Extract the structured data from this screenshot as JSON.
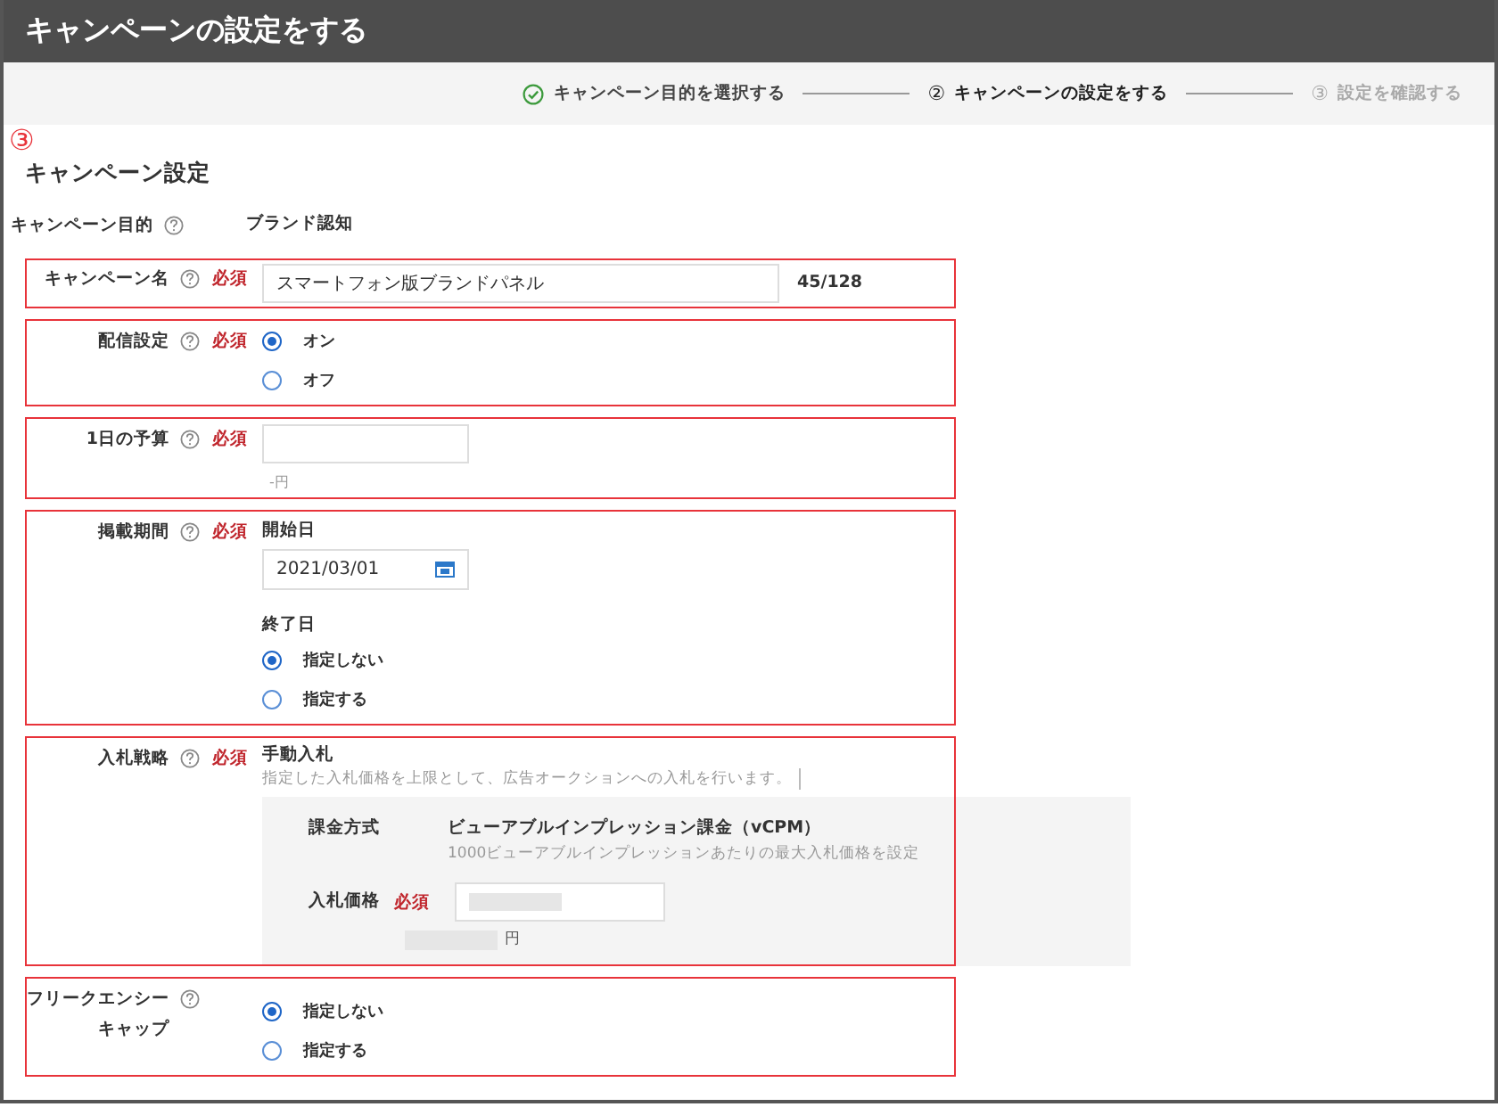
{
  "header": {
    "title": "キャンペーンの設定をする"
  },
  "steps": [
    {
      "label": "キャンペーン目的を選択する",
      "done": true,
      "selected": false
    },
    {
      "number": "②",
      "label": "キャンペーンの設定をする",
      "done": false,
      "selected": true
    },
    {
      "number": "③",
      "label": "設定を確認する",
      "done": false,
      "selected": false
    }
  ],
  "annotation": "③",
  "section_title": "キャンペーン設定",
  "fields": [
    {
      "kind": "static",
      "label": "キャンペーン目的",
      "value": "ブランド認知",
      "highlighted": false
    },
    {
      "kind": "text",
      "label": "キャンペーン名",
      "required": "必須",
      "value": "スマートフォン版ブランドパネル",
      "counter": "45/128",
      "highlighted": true
    },
    {
      "kind": "radio",
      "label": "配信設定",
      "required": "必須",
      "options": [
        {
          "label": "オン",
          "selected": true
        },
        {
          "label": "オフ",
          "selected": false
        }
      ],
      "highlighted": true
    },
    {
      "kind": "budget",
      "label": "1日の予算",
      "required": "必須",
      "note": "-円",
      "highlighted": true
    },
    {
      "kind": "period",
      "label": "掲載期間",
      "required": "必須",
      "start_label": "開始日",
      "start_value": "2021/03/01",
      "end_label": "終了日",
      "options": [
        {
          "label": "指定しない",
          "selected": true
        },
        {
          "label": "指定する",
          "selected": false
        }
      ],
      "highlighted": true
    },
    {
      "kind": "bid",
      "label": "入札戦略",
      "required": "必須",
      "strategy": "手動入札",
      "description": "指定した入札価格を上限として、広告オークションへの入札を行います。",
      "billing_label": "課金方式",
      "billing_value": "ビューアブルインプレッション課金（vCPM）",
      "billing_note": "1000ビューアブルインプレッションあたりの最大入札価格を設定",
      "price_label": "入札価格",
      "price_required": "必須",
      "price_unit": "円",
      "highlighted": true
    },
    {
      "kind": "radio",
      "label": "フリークエンシーキャップ",
      "options": [
        {
          "label": "指定しない",
          "selected": true
        },
        {
          "label": "指定する",
          "selected": false
        }
      ],
      "highlighted": true
    }
  ]
}
